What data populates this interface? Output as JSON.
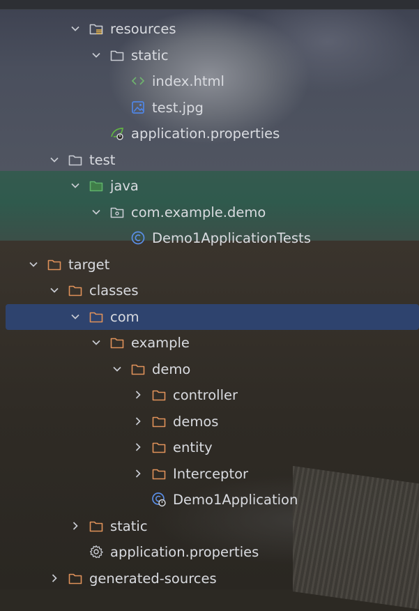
{
  "tree": [
    {
      "label": "resources",
      "icon": "resources-folder-icon",
      "expanded": true,
      "depth": 3
    },
    {
      "label": "static",
      "icon": "folder-icon",
      "expanded": true,
      "depth": 4
    },
    {
      "label": "index.html",
      "icon": "html-file-icon",
      "expanded": null,
      "depth": 5
    },
    {
      "label": "test.jpg",
      "icon": "image-file-icon",
      "expanded": null,
      "depth": 5
    },
    {
      "label": "application.properties",
      "icon": "spring-properties-icon",
      "expanded": null,
      "depth": 4
    },
    {
      "label": "test",
      "icon": "folder-icon",
      "expanded": true,
      "depth": 2
    },
    {
      "label": "java",
      "icon": "test-source-folder-icon",
      "expanded": true,
      "depth": 3
    },
    {
      "label": "com.example.demo",
      "icon": "package-icon",
      "expanded": true,
      "depth": 4
    },
    {
      "label": "Demo1ApplicationTests",
      "icon": "class-icon",
      "expanded": null,
      "depth": 5
    },
    {
      "label": "target",
      "icon": "excluded-folder-icon",
      "expanded": true,
      "depth": 1
    },
    {
      "label": "classes",
      "icon": "excluded-folder-icon",
      "expanded": true,
      "depth": 2
    },
    {
      "label": "com",
      "icon": "excluded-folder-icon",
      "expanded": true,
      "depth": 3,
      "selected": true
    },
    {
      "label": "example",
      "icon": "excluded-folder-icon",
      "expanded": true,
      "depth": 4
    },
    {
      "label": "demo",
      "icon": "excluded-folder-icon",
      "expanded": true,
      "depth": 5
    },
    {
      "label": "controller",
      "icon": "excluded-folder-icon",
      "expanded": false,
      "depth": 6
    },
    {
      "label": "demos",
      "icon": "excluded-folder-icon",
      "expanded": false,
      "depth": 6
    },
    {
      "label": "entity",
      "icon": "excluded-folder-icon",
      "expanded": false,
      "depth": 6
    },
    {
      "label": "Interceptor",
      "icon": "excluded-folder-icon",
      "expanded": false,
      "depth": 6
    },
    {
      "label": "Demo1Application",
      "icon": "spring-boot-class-icon",
      "expanded": null,
      "depth": 6
    },
    {
      "label": "static",
      "icon": "excluded-folder-icon",
      "expanded": false,
      "depth": 3
    },
    {
      "label": "application.properties",
      "icon": "settings-file-icon",
      "expanded": null,
      "depth": 3
    },
    {
      "label": "generated-sources",
      "icon": "excluded-folder-icon",
      "expanded": false,
      "depth": 2
    }
  ],
  "colors": {
    "selection": "#2e436e",
    "folder_default": "#c9ccd3",
    "folder_excluded": "#e0925a",
    "folder_test": "#5fb16b",
    "html_icon": "#6fb36e",
    "image_icon": "#4f86e6",
    "class_icon": "#5a8ee6",
    "spring_icon": "#62b543"
  }
}
